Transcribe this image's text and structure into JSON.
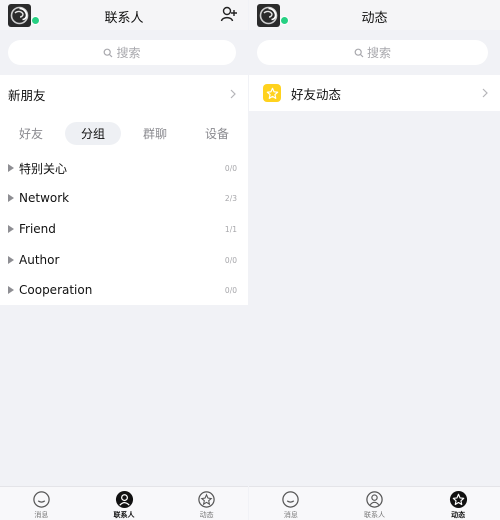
{
  "left": {
    "header": {
      "title": "联系人"
    },
    "search": {
      "placeholder": "搜索"
    },
    "new_friends": {
      "label": "新朋友"
    },
    "tabs": [
      {
        "label": "好友",
        "active": false
      },
      {
        "label": "分组",
        "active": true
      },
      {
        "label": "群聊",
        "active": false
      },
      {
        "label": "设备",
        "active": false
      }
    ],
    "groups": [
      {
        "name": "特别关心",
        "count": "0/0"
      },
      {
        "name": "Network",
        "count": "2/3"
      },
      {
        "name": "Friend",
        "count": "1/1"
      },
      {
        "name": "Author",
        "count": "0/0"
      },
      {
        "name": "Cooperation",
        "count": "0/0"
      }
    ],
    "bottom_nav": [
      {
        "label": "消息",
        "icon": "message-icon",
        "active": false
      },
      {
        "label": "联系人",
        "icon": "contacts-icon",
        "active": true
      },
      {
        "label": "动态",
        "icon": "star-icon",
        "active": false
      }
    ]
  },
  "right": {
    "header": {
      "title": "动态"
    },
    "search": {
      "placeholder": "搜索"
    },
    "feed": {
      "label": "好友动态",
      "icon": "star-icon"
    },
    "bottom_nav": [
      {
        "label": "消息",
        "icon": "message-icon",
        "active": false
      },
      {
        "label": "联系人",
        "icon": "contacts-icon",
        "active": false
      },
      {
        "label": "动态",
        "icon": "star-icon",
        "active": true
      }
    ]
  },
  "colors": {
    "online": "#27d083",
    "feed_icon": "#ffd21e",
    "background": "#f1f2f6"
  }
}
